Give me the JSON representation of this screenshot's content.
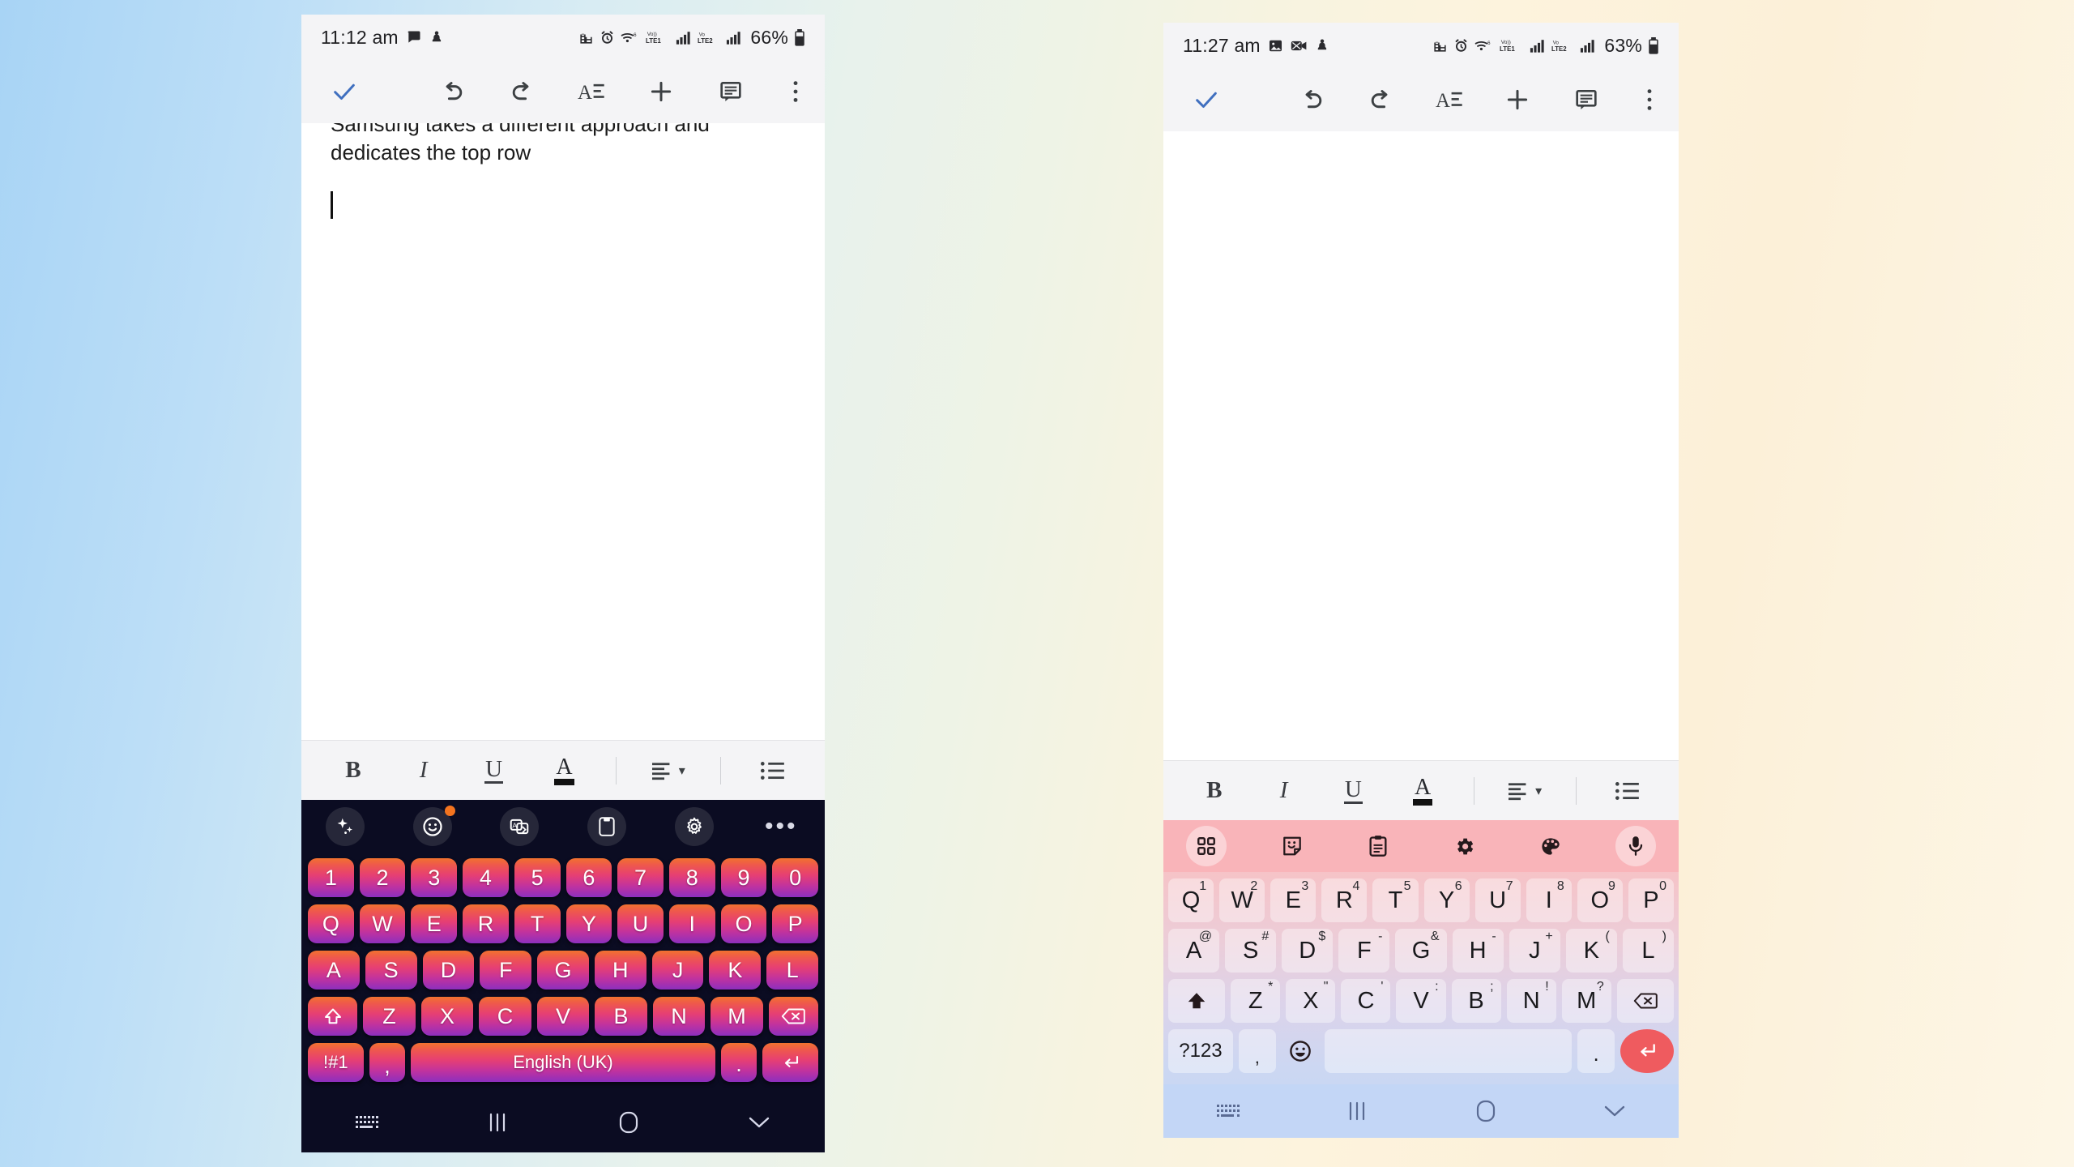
{
  "background": {
    "gradient_from": "#a8d4f5",
    "gradient_mid": "#eef3e6",
    "gradient_to": "#fdf6e6"
  },
  "phones": [
    {
      "id": "left",
      "status_bar": {
        "time": "11:12 am",
        "battery_percent": "66%",
        "left_icons": [
          "chat-bubble-icon",
          "do-not-disturb-icon"
        ],
        "right_icons": [
          "work-profile-icon",
          "alarm-icon",
          "wifi-6-icon",
          "volte-lte1-icon",
          "signal-bars-icon",
          "volte-lte2-icon",
          "signal-bars-2-icon"
        ],
        "battery_icon": "battery-icon"
      },
      "doc_toolbar": {
        "items": [
          {
            "name": "done-check-button",
            "icon": "check-icon",
            "label": "Done"
          },
          {
            "name": "undo-button",
            "icon": "undo-icon",
            "label": "Undo"
          },
          {
            "name": "redo-button",
            "icon": "redo-icon",
            "label": "Redo"
          },
          {
            "name": "format-button",
            "icon": "text-format-icon",
            "label": "Format"
          },
          {
            "name": "insert-button",
            "icon": "plus-icon",
            "label": "Insert"
          },
          {
            "name": "comment-button",
            "icon": "comment-icon",
            "label": "Comment"
          },
          {
            "name": "overflow-menu-button",
            "icon": "more-vertical-icon",
            "label": "More options"
          }
        ]
      },
      "document": {
        "line_clipped": "Samsung takes a different approach and",
        "line_2": "dedicates the top row",
        "caret_visible": true
      },
      "format_bar": {
        "bold": "B",
        "italic": "I",
        "underline": "U",
        "text_color": "A",
        "align": "align-left-icon",
        "align_caret": "▾",
        "list": "bulleted-list-icon"
      },
      "keyboard": {
        "theme": "neon-dark",
        "background": "#0b0c22",
        "key_gradient_top": "#f0722f",
        "key_gradient_bottom": "#8c2fbe",
        "toolbar": [
          {
            "name": "ai-assist-icon",
            "label": "AI"
          },
          {
            "name": "emoji-icon",
            "label": "Emoji",
            "badge": true
          },
          {
            "name": "translate-icon",
            "label": "Translate"
          },
          {
            "name": "clipboard-icon",
            "label": "Clipboard"
          },
          {
            "name": "settings-gear-icon",
            "label": "Settings"
          },
          {
            "name": "more-horizontal-icon",
            "label": "More"
          }
        ],
        "row_numbers": [
          "1",
          "2",
          "3",
          "4",
          "5",
          "6",
          "7",
          "8",
          "9",
          "0"
        ],
        "row_1": [
          "Q",
          "W",
          "E",
          "R",
          "T",
          "Y",
          "U",
          "I",
          "O",
          "P"
        ],
        "row_2": [
          "A",
          "S",
          "D",
          "F",
          "G",
          "H",
          "J",
          "K",
          "L"
        ],
        "row_3": [
          "Z",
          "X",
          "C",
          "V",
          "B",
          "N",
          "M"
        ],
        "shift_label": "shift-icon",
        "backspace_label": "backspace-icon",
        "bottom": {
          "symbols": "!#1",
          "comma": ",",
          "space": "English (UK)",
          "period": ".",
          "enter": "enter-icon"
        }
      },
      "nav_bar": {
        "items": [
          "keyboard-hide-icon",
          "recents-icon",
          "home-icon",
          "collapse-chevron-icon"
        ]
      }
    },
    {
      "id": "right",
      "status_bar": {
        "time": "11:27 am",
        "battery_percent": "63%",
        "left_icons": [
          "photo-icon",
          "screen-record-icon",
          "do-not-disturb-icon"
        ],
        "right_icons": [
          "work-profile-icon",
          "alarm-icon",
          "wifi-6-icon",
          "volte-lte1-icon",
          "signal-bars-icon",
          "volte-lte2-icon",
          "signal-bars-2-icon"
        ],
        "battery_icon": "battery-icon"
      },
      "doc_toolbar": {
        "items": [
          {
            "name": "done-check-button",
            "icon": "check-icon",
            "label": "Done"
          },
          {
            "name": "undo-button",
            "icon": "undo-icon",
            "label": "Undo"
          },
          {
            "name": "redo-button",
            "icon": "redo-icon",
            "label": "Redo"
          },
          {
            "name": "format-button",
            "icon": "text-format-icon",
            "label": "Format"
          },
          {
            "name": "insert-button",
            "icon": "plus-icon",
            "label": "Insert"
          },
          {
            "name": "comment-button",
            "icon": "comment-icon",
            "label": "Comment"
          },
          {
            "name": "overflow-menu-button",
            "icon": "more-vertical-icon",
            "label": "More options"
          }
        ]
      },
      "document": {
        "line_clipped": "",
        "line_2": "",
        "caret_visible": false
      },
      "format_bar": {
        "bold": "B",
        "italic": "I",
        "underline": "U",
        "text_color": "A",
        "align": "align-left-icon",
        "align_caret": "▾",
        "list": "bulleted-list-icon"
      },
      "keyboard": {
        "theme": "pastel-pink",
        "background_top": "#f8b8bd",
        "background_bottom": "#c3d6f6",
        "enter_key_color": "#ef5b5f",
        "toolbar": [
          {
            "name": "grid-apps-icon",
            "label": "Toolbar"
          },
          {
            "name": "sticker-icon",
            "label": "Stickers"
          },
          {
            "name": "clipboard-icon",
            "label": "Clipboard"
          },
          {
            "name": "settings-gear-icon",
            "label": "Settings"
          },
          {
            "name": "palette-icon",
            "label": "Themes"
          },
          {
            "name": "microphone-icon",
            "label": "Voice input"
          }
        ],
        "row_1": [
          {
            "key": "Q",
            "sup": "1"
          },
          {
            "key": "W",
            "sup": "2"
          },
          {
            "key": "E",
            "sup": "3"
          },
          {
            "key": "R",
            "sup": "4"
          },
          {
            "key": "T",
            "sup": "5"
          },
          {
            "key": "Y",
            "sup": "6"
          },
          {
            "key": "U",
            "sup": "7"
          },
          {
            "key": "I",
            "sup": "8"
          },
          {
            "key": "O",
            "sup": "9"
          },
          {
            "key": "P",
            "sup": "0"
          }
        ],
        "row_2": [
          {
            "key": "A",
            "sup": "@"
          },
          {
            "key": "S",
            "sup": "#"
          },
          {
            "key": "D",
            "sup": "$"
          },
          {
            "key": "F",
            "sup": "-"
          },
          {
            "key": "G",
            "sup": "&"
          },
          {
            "key": "H",
            "sup": "-"
          },
          {
            "key": "J",
            "sup": "+"
          },
          {
            "key": "K",
            "sup": "("
          },
          {
            "key": "L",
            "sup": ")"
          }
        ],
        "row_3": [
          {
            "key": "Z",
            "sup": "*"
          },
          {
            "key": "X",
            "sup": "\""
          },
          {
            "key": "C",
            "sup": "'"
          },
          {
            "key": "V",
            "sup": ":"
          },
          {
            "key": "B",
            "sup": ";"
          },
          {
            "key": "N",
            "sup": "!"
          },
          {
            "key": "M",
            "sup": "?"
          }
        ],
        "shift_label": "shift-icon",
        "backspace_label": "backspace-icon",
        "bottom": {
          "symbols": "?123",
          "comma": ",",
          "emoji": "emoji-icon",
          "space": "",
          "period": ".",
          "enter": "enter-icon"
        }
      },
      "nav_bar": {
        "items": [
          "keyboard-hide-icon",
          "recents-icon",
          "home-icon",
          "collapse-chevron-icon"
        ]
      }
    }
  ]
}
